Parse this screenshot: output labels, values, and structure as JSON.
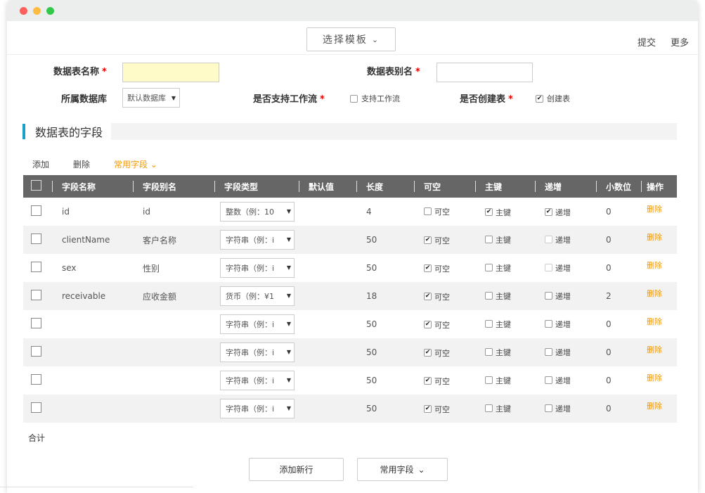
{
  "topbar": {
    "template_btn": "选择模板",
    "submit": "提交",
    "more": "更多"
  },
  "form": {
    "table_name_label": "数据表名称",
    "table_alias_label": "数据表别名",
    "database_label": "所属数据库",
    "database_value": "默认数据库",
    "workflow_label": "是否支持工作流",
    "workflow_option": "支持工作流",
    "create_label": "是否创建表",
    "create_option": "创建表",
    "required_mark": "*"
  },
  "section": {
    "title": "数据表的字段"
  },
  "toolbar": {
    "add": "添加",
    "delete": "删除",
    "common_fields": "常用字段"
  },
  "table": {
    "headers": [
      "字段名称",
      "字段别名",
      "字段类型",
      "默认值",
      "长度",
      "可空",
      "主键",
      "递增",
      "小数位",
      "操作"
    ],
    "labels": {
      "nullable": "可空",
      "pk": "主键",
      "inc": "递增",
      "delete": "删除"
    },
    "rows": [
      {
        "name": "id",
        "alias": "id",
        "type": "整数（例：10",
        "length": "4",
        "nullable": false,
        "pk": true,
        "inc": true,
        "inc_disabled": false,
        "decimal": "0"
      },
      {
        "name": "clientName",
        "alias": "客户名称",
        "type": "字符串（例：i",
        "length": "50",
        "nullable": true,
        "pk": false,
        "inc": false,
        "inc_disabled": true,
        "decimal": "0"
      },
      {
        "name": "sex",
        "alias": "性别",
        "type": "字符串（例：i",
        "length": "50",
        "nullable": true,
        "pk": false,
        "inc": false,
        "inc_disabled": true,
        "decimal": "0"
      },
      {
        "name": "receivable",
        "alias": "应收金额",
        "type": "货币（例：¥1",
        "length": "18",
        "nullable": true,
        "pk": false,
        "inc": false,
        "inc_disabled": false,
        "decimal": "2"
      },
      {
        "name": "",
        "alias": "",
        "type": "字符串（例：i",
        "length": "50",
        "nullable": true,
        "pk": false,
        "inc": false,
        "inc_disabled": false,
        "decimal": "0"
      },
      {
        "name": "",
        "alias": "",
        "type": "字符串（例：i",
        "length": "50",
        "nullable": true,
        "pk": false,
        "inc": false,
        "inc_disabled": false,
        "decimal": "0"
      },
      {
        "name": "",
        "alias": "",
        "type": "字符串（例：i",
        "length": "50",
        "nullable": true,
        "pk": false,
        "inc": false,
        "inc_disabled": false,
        "decimal": "0"
      },
      {
        "name": "",
        "alias": "",
        "type": "字符串（例：i",
        "length": "50",
        "nullable": true,
        "pk": false,
        "inc": false,
        "inc_disabled": false,
        "decimal": "0"
      }
    ]
  },
  "footer": {
    "total": "合计",
    "add_row": "添加新行",
    "common_fields": "常用字段"
  },
  "colors": {
    "accent": "#1ba1c8",
    "orange": "#f39800",
    "header_bg": "#666666",
    "required": "#ee0000"
  }
}
